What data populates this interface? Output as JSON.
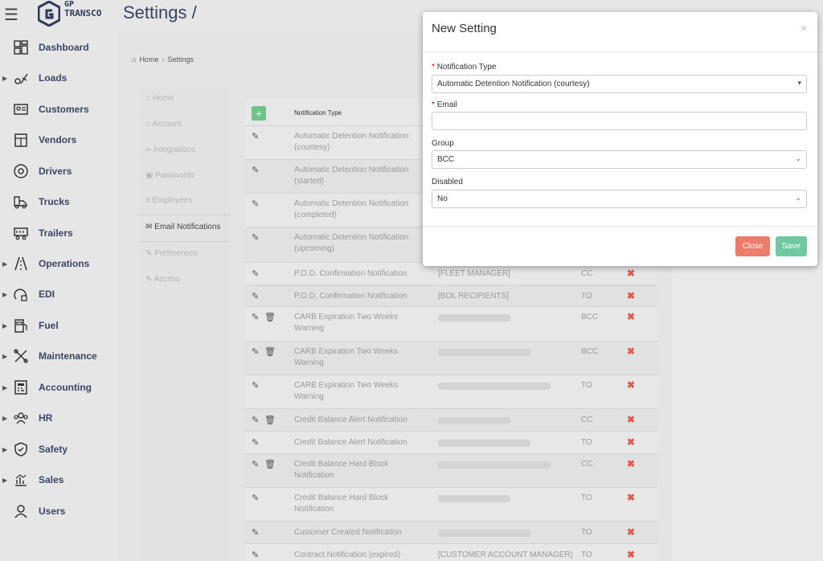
{
  "header": {
    "menu_icon": "hamburger-icon",
    "logo_line1": "GP",
    "logo_line2": "TRANSCO",
    "page_title": "Settings /"
  },
  "sidebar": {
    "items": [
      {
        "label": "Dashboard",
        "icon": "dashboard-icon",
        "caret": false
      },
      {
        "label": "Loads",
        "icon": "loads-icon",
        "caret": true
      },
      {
        "label": "Customers",
        "icon": "customers-icon",
        "caret": false
      },
      {
        "label": "Vendors",
        "icon": "vendors-icon",
        "caret": false
      },
      {
        "label": "Drivers",
        "icon": "drivers-icon",
        "caret": false
      },
      {
        "label": "Trucks",
        "icon": "trucks-icon",
        "caret": false
      },
      {
        "label": "Trailers",
        "icon": "trailers-icon",
        "caret": false
      },
      {
        "label": "Operations",
        "icon": "operations-icon",
        "caret": true
      },
      {
        "label": "EDI",
        "icon": "edi-icon",
        "caret": true
      },
      {
        "label": "Fuel",
        "icon": "fuel-icon",
        "caret": true
      },
      {
        "label": "Maintenance",
        "icon": "maintenance-icon",
        "caret": true
      },
      {
        "label": "Accounting",
        "icon": "accounting-icon",
        "caret": true
      },
      {
        "label": "HR",
        "icon": "hr-icon",
        "caret": true
      },
      {
        "label": "Safety",
        "icon": "safety-icon",
        "caret": true
      },
      {
        "label": "Sales",
        "icon": "sales-icon",
        "caret": true
      },
      {
        "label": "Users",
        "icon": "users-icon",
        "caret": false
      }
    ]
  },
  "breadcrumb": {
    "home": "Home",
    "sep": "›",
    "current": "Settings"
  },
  "settings_nav": {
    "items": [
      {
        "label": "Home",
        "icon": "home-icon"
      },
      {
        "label": "Account",
        "icon": "account-icon"
      },
      {
        "label": "Integrations",
        "icon": "link-icon"
      },
      {
        "label": "Passwords",
        "icon": "lock-icon"
      },
      {
        "label": "Employees",
        "icon": "list-icon"
      },
      {
        "label": "Email Notifications",
        "icon": "envelope-icon"
      },
      {
        "label": "Preferences",
        "icon": "wrench-icon"
      },
      {
        "label": "Access",
        "icon": "wrench-icon"
      }
    ],
    "active_index": 5
  },
  "table": {
    "add_label": "+",
    "header_type": "Notification Type",
    "rows": [
      {
        "type": "Automatic Detention Notification (courtesy)",
        "email": "",
        "group": "",
        "del": "",
        "trash": false
      },
      {
        "type": "Automatic Detention Notification (started)",
        "email": "",
        "group": "",
        "del": "",
        "trash": false
      },
      {
        "type": "Automatic Detention Notification (completed)",
        "email": "",
        "group": "",
        "del": "",
        "trash": false
      },
      {
        "type": "Automatic Detention Notification (upcoming)",
        "email": "",
        "group": "",
        "del": "",
        "trash": false
      },
      {
        "type": "P.O.D. Confirmation Notification",
        "email": "[FLEET MANAGER]",
        "group": "CC",
        "del": "✖",
        "trash": false
      },
      {
        "type": "P.O.D. Confirmation Notification",
        "email": "[BOL RECIPIENTS]",
        "group": "TO",
        "del": "✖",
        "trash": false
      },
      {
        "type": "CARB Expiration Two Weeks Warning",
        "email": "",
        "group": "BCC",
        "del": "✖",
        "trash": true
      },
      {
        "type": "CARB Expiration Two Weeks Warning",
        "email": "",
        "group": "BCC",
        "del": "✖",
        "trash": true
      },
      {
        "type": "CARB Expiration Two Weeks Warning",
        "email": "",
        "group": "TO",
        "del": "✖",
        "trash": false
      },
      {
        "type": "Credit Balance Alert Notification",
        "email": "",
        "group": "CC",
        "del": "✖",
        "trash": true
      },
      {
        "type": "Credit Balance Alert Notification",
        "email": "",
        "group": "TO",
        "del": "✖",
        "trash": false
      },
      {
        "type": "Credit Balance Hard Block Notification",
        "email": "",
        "group": "CC",
        "del": "✖",
        "trash": true
      },
      {
        "type": "Credit Balance Hard Block Notification",
        "email": "",
        "group": "TO",
        "del": "✖",
        "trash": false
      },
      {
        "type": "Customer Created Notification",
        "email": "",
        "group": "TO",
        "del": "✖",
        "trash": false
      },
      {
        "type": "Contract Notification (expired)",
        "email": "[CUSTOMER ACCOUNT MANAGER]",
        "group": "TO",
        "del": "✖",
        "trash": false
      }
    ]
  },
  "modal": {
    "title": "New Setting",
    "close_glyph": "×",
    "required_mark": "*",
    "notification_type_label": "Notification Type",
    "notification_type_value": "Automatic Detention Notification (courtesy)",
    "email_label": "Email",
    "email_value": "",
    "group_label": "Group",
    "group_value": "BCC",
    "disabled_label": "Disabled",
    "disabled_value": "No",
    "close_button": "Close",
    "save_button": "Save"
  },
  "colors": {
    "save": "#6fc9a0",
    "close": "#ef7b6b",
    "delete": "#e05a4a",
    "add": "#6fc48c",
    "brand": "#2d3a5a"
  }
}
